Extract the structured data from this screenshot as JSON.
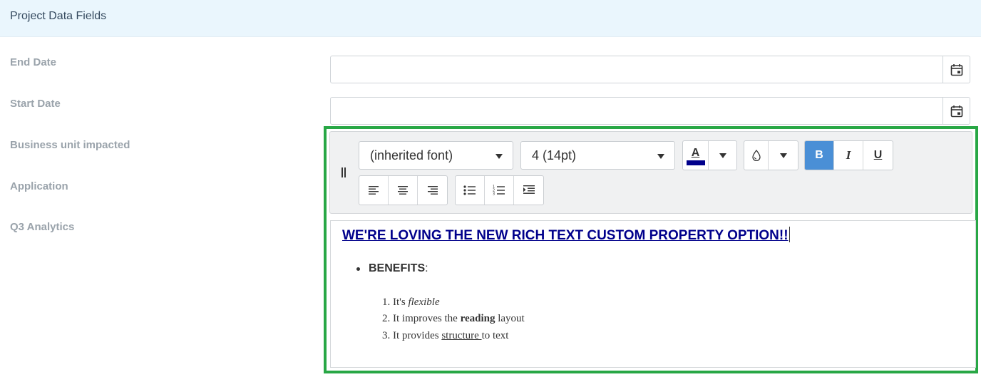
{
  "panel": {
    "title": "Project Data Fields"
  },
  "fields": [
    {
      "label": "End Date",
      "value": ""
    },
    {
      "label": "Start Date",
      "value": ""
    },
    {
      "label": "Business unit impacted"
    },
    {
      "label": "Application"
    },
    {
      "label": "Q3 Analytics"
    }
  ],
  "toolbar": {
    "font_family": "(inherited font)",
    "font_size": "4 (14pt)",
    "text_color_letter": "A",
    "text_color": "#00008b",
    "bold": "B",
    "italic": "I",
    "underline": "U",
    "bold_active": true
  },
  "editor": {
    "headline": "WE'RE LOVING THE NEW RICH TEXT CUSTOM PROPERTY OPTION!!",
    "bullet_bold": "BENEFITS",
    "bullet_rest": ":",
    "items": [
      {
        "num": "1.",
        "pre": "It's ",
        "em": "flexible",
        "post": ""
      },
      {
        "num": "2.",
        "pre": "It improves the ",
        "strong": "reading",
        "post": " layout"
      },
      {
        "num": "3.",
        "pre": "It provides ",
        "u": "structure ",
        "post": "to text"
      }
    ]
  },
  "colors": {
    "accent_border": "#28a745",
    "active_button": "#4a8fd6",
    "headline": "#00008b"
  }
}
